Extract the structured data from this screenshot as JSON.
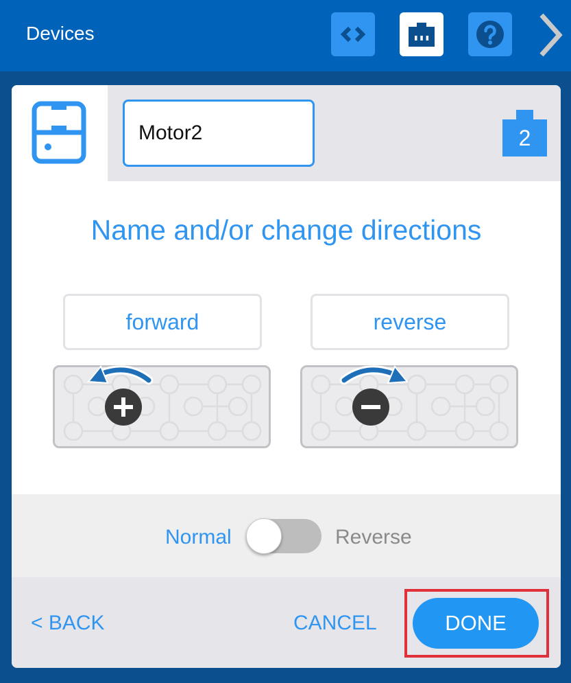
{
  "header": {
    "title": "Devices",
    "buttons": {
      "code": "code-icon",
      "ports": "port-icon",
      "help": "help-icon",
      "next": "chevron-right-icon"
    }
  },
  "device": {
    "icon": "motor-device-icon",
    "name_value": "Motor2",
    "port_number": "2"
  },
  "main": {
    "heading": "Name and/or change directions",
    "directions": {
      "forward_label": "forward",
      "reverse_label": "reverse",
      "forward_sign": "plus-icon",
      "reverse_sign": "minus-icon"
    }
  },
  "toggle": {
    "left_label": "Normal",
    "right_label": "Reverse",
    "state": "Normal"
  },
  "footer": {
    "back_label": "< BACK",
    "cancel_label": "CANCEL",
    "done_label": "DONE"
  },
  "colors": {
    "accent": "#2f95f0",
    "topbar": "#0063b9",
    "background": "#0b4f8f",
    "highlight": "#e0313a",
    "arrow": "#1f6fb8",
    "sign": "#3a3a3a"
  }
}
